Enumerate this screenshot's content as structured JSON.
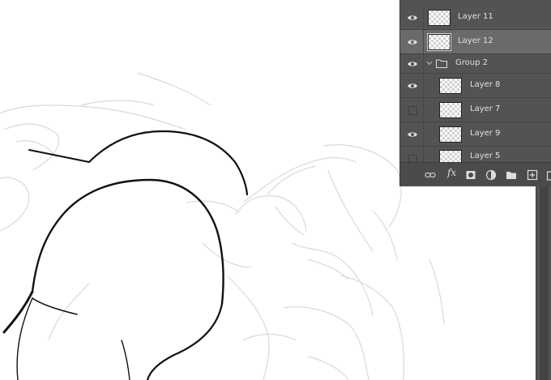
{
  "layers_panel": {
    "layers": [
      {
        "name": "Layer 11",
        "visible": true,
        "selected": false,
        "type": "layer"
      },
      {
        "name": "Layer 12",
        "visible": true,
        "selected": true,
        "type": "layer"
      },
      {
        "name": "Group 2",
        "visible": true,
        "selected": false,
        "type": "group"
      },
      {
        "name": "Layer 8",
        "visible": true,
        "selected": false,
        "type": "layer"
      },
      {
        "name": "Layer 7",
        "visible": false,
        "selected": false,
        "type": "layer"
      },
      {
        "name": "Layer 9",
        "visible": true,
        "selected": false,
        "type": "layer"
      },
      {
        "name": "Layer 5",
        "visible": false,
        "selected": false,
        "type": "layer"
      }
    ],
    "footer": {
      "fx_label": "fx",
      "icons": [
        "link-icon",
        "fx-icon",
        "mask-icon",
        "adjustment-icon",
        "folder-icon",
        "new-layer-icon",
        "trash-icon"
      ]
    }
  },
  "colors": {
    "panel_bg": "#535353",
    "selected_row": "#6a6a6a",
    "text": "#e0e0e0",
    "canvas": "#ffffff"
  }
}
